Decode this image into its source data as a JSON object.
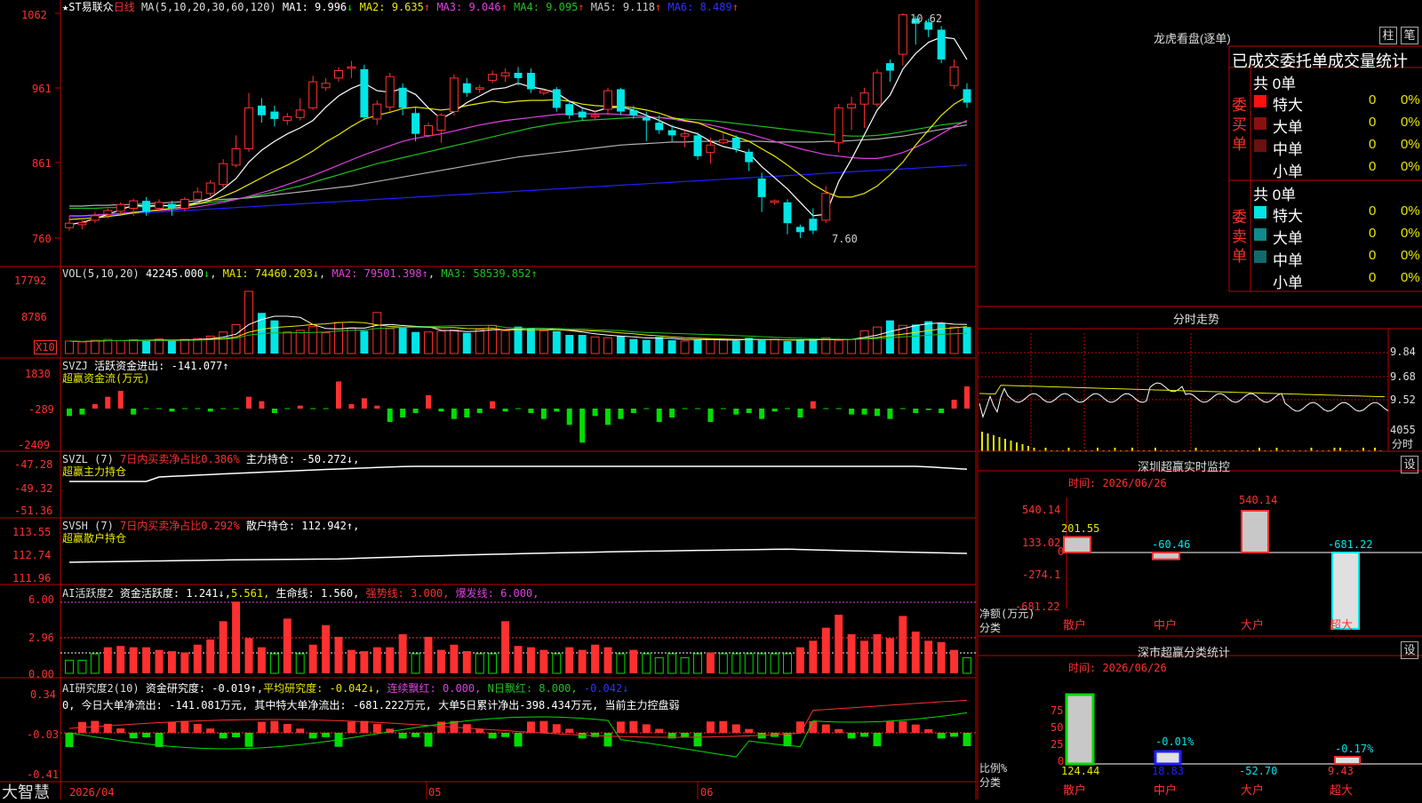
{
  "colors": {
    "up": "#ff3030",
    "down": "#00e5e5",
    "border": "#c00000",
    "ma1": "#ffffff",
    "ma2": "#e8e800",
    "ma3": "#e040e0",
    "ma4": "#20c020",
    "ma5": "#b0b0b0",
    "ma6": "#2020ff",
    "green": "#00dd00"
  },
  "header": {
    "stock": "★ST易联众",
    "period": "日线",
    "ma_label": "MA(5,10,20,30,60,120)",
    "ma": [
      {
        "name": "MA1",
        "value": "9.996",
        "arrow": "↓"
      },
      {
        "name": "MA2",
        "value": "9.635",
        "arrow": "↑"
      },
      {
        "name": "MA3",
        "value": "9.046",
        "arrow": "↑"
      },
      {
        "name": "MA4",
        "value": "9.095",
        "arrow": "↑"
      },
      {
        "name": "MA5",
        "value": "9.118",
        "arrow": "↑"
      },
      {
        "name": "MA6",
        "value": "8.489",
        "arrow": "↑"
      }
    ],
    "high_mark": "10.62",
    "low_mark": "7.60"
  },
  "price_axis": [
    "1062",
    "961",
    "861",
    "760"
  ],
  "vol": {
    "label": "VOL(5,10,20)",
    "value": "42245.000",
    "arrow": "↓",
    "ma1": "MA1: 74460.203↓",
    "ma2": "MA2: 79501.398↑",
    "ma3": "MA3: 58539.852↑",
    "axis": [
      "17792",
      "8786"
    ],
    "unit": "X10"
  },
  "svzj": {
    "label": "SVZJ",
    "title": "活跃资金进出: -141.077↑",
    "sub": "超赢资金流(万元)",
    "axis": [
      "1830",
      "-289",
      "-2409"
    ]
  },
  "svzl": {
    "label": "SVZL (7)",
    "pct": "7日内买卖净占比0.386%",
    "hold": "主力持仓: -50.272↓,",
    "sub": "超赢主力持仓",
    "axis": [
      "-47.28",
      "-49.32",
      "-51.36"
    ]
  },
  "svsh": {
    "label": "SVSH (7)",
    "pct": "7日内买卖净占比0.292%",
    "hold": "散户持仓: 112.942↑,",
    "sub": "超赢散户持仓",
    "axis": [
      "113.55",
      "112.74",
      "111.96"
    ]
  },
  "ai1": {
    "label": "AI活跃度2",
    "a": "资金活跃度: 1.241↓,",
    "b": "5.561,",
    "c": "生命线: 1.560,",
    "d": "强势线: 3.000,",
    "e": "爆发线: 6.000,",
    "axis": [
      "6.00",
      "2.96",
      "0.00"
    ]
  },
  "ai2": {
    "label": "AI研究度2(10)",
    "a": "资金研究度: -0.019↑,",
    "b": "平均研究度: -0.042↓,",
    "c": "连续飘红: 0.000,",
    "d": "N日飘红: 8.000,",
    "e": "-0.042↓",
    "note": "0, 今日大单净流出: -141.081万元, 其中特大单净流出: -681.222万元, 大单5日累计净出-398.434万元, 当前主力控盘弱",
    "axis": [
      "0.34",
      "-0.03",
      "-0.41"
    ]
  },
  "xaxis": {
    "labels": [
      "2026/04",
      "05",
      "06"
    ]
  },
  "brand": "大智慧",
  "right": {
    "title": "龙虎看盘(逐单)",
    "btn1": "柱",
    "btn2": "笔",
    "table_title": "已成交委托单成交量统计",
    "buy": {
      "side": "委买单",
      "total": "共 0单",
      "rows": [
        {
          "name": "特大",
          "v": "0",
          "p": "0%"
        },
        {
          "name": "大单",
          "v": "0",
          "p": "0%"
        },
        {
          "name": "中单",
          "v": "0",
          "p": "0%"
        },
        {
          "name": "小单",
          "v": "0",
          "p": "0%"
        }
      ]
    },
    "sell": {
      "side": "委卖单",
      "total": "共 0单",
      "rows": [
        {
          "name": "特大",
          "v": "0",
          "p": "0%"
        },
        {
          "name": "大单",
          "v": "0",
          "p": "0%"
        },
        {
          "name": "中单",
          "v": "0",
          "p": "0%"
        },
        {
          "name": "小单",
          "v": "0",
          "p": "0%"
        }
      ]
    },
    "intraday": {
      "title": "分时走势",
      "axis": [
        "9.84",
        "9.68",
        "9.52"
      ],
      "vol": "4055",
      "vol_unit": "分时"
    },
    "monitor": {
      "title": "深圳超赢实时监控",
      "btn": "设",
      "time": "时间: 2026/06/26",
      "axis": [
        "540.14",
        "133.02",
        "0",
        "-274.1",
        "-681.22"
      ],
      "ylabel": "净额(万元)",
      "xlabel": "分类",
      "cats": [
        "散户",
        "中户",
        "大户",
        "超大"
      ],
      "values": [
        "201.55",
        "-60.46",
        "540.14",
        "-681.22"
      ]
    },
    "stats": {
      "title": "深市超赢分类统计",
      "btn": "设",
      "time": "时间: 2026/06/26",
      "axis": [
        "75",
        "50",
        "25",
        "0"
      ],
      "ylabel": "比例%",
      "xlabel": "分类",
      "cats": [
        "散户",
        "中户",
        "大户",
        "超大"
      ],
      "values": [
        "124.44",
        "18.83",
        "-52.70",
        "9.43"
      ],
      "pct": [
        "-0.01%",
        "-0.17%"
      ]
    }
  },
  "chart_data": {
    "type": "candlestick",
    "ylim": [
      760,
      1062
    ],
    "candles": [
      {
        "o": 774,
        "c": 780,
        "h": 790,
        "l": 770
      },
      {
        "o": 778,
        "c": 781,
        "h": 784,
        "l": 772
      },
      {
        "o": 784,
        "c": 790,
        "h": 795,
        "l": 780
      },
      {
        "o": 792,
        "c": 797,
        "h": 800,
        "l": 786
      },
      {
        "o": 796,
        "c": 805,
        "h": 808,
        "l": 792
      },
      {
        "o": 800,
        "c": 810,
        "h": 813,
        "l": 790
      },
      {
        "o": 810,
        "c": 795,
        "h": 815,
        "l": 790
      },
      {
        "o": 800,
        "c": 808,
        "h": 812,
        "l": 796
      },
      {
        "o": 806,
        "c": 800,
        "h": 810,
        "l": 790
      },
      {
        "o": 800,
        "c": 812,
        "h": 815,
        "l": 796
      },
      {
        "o": 812,
        "c": 822,
        "h": 828,
        "l": 808
      },
      {
        "o": 820,
        "c": 834,
        "h": 838,
        "l": 816
      },
      {
        "o": 832,
        "c": 860,
        "h": 866,
        "l": 828
      },
      {
        "o": 858,
        "c": 880,
        "h": 898,
        "l": 855
      },
      {
        "o": 880,
        "c": 935,
        "h": 955,
        "l": 876
      },
      {
        "o": 938,
        "c": 925,
        "h": 948,
        "l": 915
      },
      {
        "o": 930,
        "c": 920,
        "h": 938,
        "l": 910
      },
      {
        "o": 918,
        "c": 923,
        "h": 928,
        "l": 912
      },
      {
        "o": 922,
        "c": 932,
        "h": 948,
        "l": 918
      },
      {
        "o": 935,
        "c": 970,
        "h": 978,
        "l": 932
      },
      {
        "o": 962,
        "c": 968,
        "h": 975,
        "l": 958
      },
      {
        "o": 975,
        "c": 985,
        "h": 990,
        "l": 970
      },
      {
        "o": 988,
        "c": 990,
        "h": 998,
        "l": 975
      },
      {
        "o": 987,
        "c": 922,
        "h": 993,
        "l": 918
      },
      {
        "o": 920,
        "c": 940,
        "h": 945,
        "l": 912
      },
      {
        "o": 936,
        "c": 977,
        "h": 982,
        "l": 930
      },
      {
        "o": 962,
        "c": 935,
        "h": 968,
        "l": 925
      },
      {
        "o": 928,
        "c": 900,
        "h": 935,
        "l": 890
      },
      {
        "o": 898,
        "c": 911,
        "h": 915,
        "l": 895
      },
      {
        "o": 905,
        "c": 925,
        "h": 928,
        "l": 888
      },
      {
        "o": 930,
        "c": 975,
        "h": 980,
        "l": 925
      },
      {
        "o": 968,
        "c": 955,
        "h": 975,
        "l": 950
      },
      {
        "o": 960,
        "c": 962,
        "h": 966,
        "l": 955
      },
      {
        "o": 972,
        "c": 980,
        "h": 985,
        "l": 968
      },
      {
        "o": 978,
        "c": 982,
        "h": 988,
        "l": 970
      },
      {
        "o": 982,
        "c": 975,
        "h": 990,
        "l": 965
      },
      {
        "o": 982,
        "c": 960,
        "h": 988,
        "l": 955
      },
      {
        "o": 955,
        "c": 958,
        "h": 960,
        "l": 952
      },
      {
        "o": 960,
        "c": 935,
        "h": 963,
        "l": 930
      },
      {
        "o": 940,
        "c": 925,
        "h": 945,
        "l": 920
      },
      {
        "o": 930,
        "c": 922,
        "h": 934,
        "l": 918
      },
      {
        "o": 923,
        "c": 925,
        "h": 932,
        "l": 918
      },
      {
        "o": 933,
        "c": 958,
        "h": 962,
        "l": 925
      },
      {
        "o": 960,
        "c": 930,
        "h": 962,
        "l": 925
      },
      {
        "o": 932,
        "c": 925,
        "h": 938,
        "l": 920
      },
      {
        "o": 922,
        "c": 918,
        "h": 930,
        "l": 890
      },
      {
        "o": 915,
        "c": 905,
        "h": 925,
        "l": 900
      },
      {
        "o": 905,
        "c": 898,
        "h": 912,
        "l": 890
      },
      {
        "o": 897,
        "c": 900,
        "h": 905,
        "l": 882
      },
      {
        "o": 898,
        "c": 870,
        "h": 902,
        "l": 865
      },
      {
        "o": 875,
        "c": 885,
        "h": 895,
        "l": 860
      },
      {
        "o": 888,
        "c": 892,
        "h": 902,
        "l": 886
      },
      {
        "o": 895,
        "c": 880,
        "h": 898,
        "l": 875
      },
      {
        "o": 876,
        "c": 862,
        "h": 880,
        "l": 850
      },
      {
        "o": 840,
        "c": 815,
        "h": 848,
        "l": 795
      },
      {
        "o": 808,
        "c": 810,
        "h": 812,
        "l": 805
      },
      {
        "o": 808,
        "c": 780,
        "h": 812,
        "l": 765
      },
      {
        "o": 775,
        "c": 768,
        "h": 778,
        "l": 760
      },
      {
        "o": 786,
        "c": 770,
        "h": 800,
        "l": 765
      },
      {
        "o": 784,
        "c": 820,
        "h": 830,
        "l": 780
      },
      {
        "o": 888,
        "c": 935,
        "h": 940,
        "l": 875
      },
      {
        "o": 935,
        "c": 940,
        "h": 950,
        "l": 905
      },
      {
        "o": 940,
        "c": 955,
        "h": 962,
        "l": 908
      },
      {
        "o": 940,
        "c": 982,
        "h": 987,
        "l": 936
      },
      {
        "o": 995,
        "c": 985,
        "h": 1000,
        "l": 970
      },
      {
        "o": 1007,
        "c": 1060,
        "h": 1062,
        "l": 992
      },
      {
        "o": 1055,
        "c": 1048,
        "h": 1058,
        "l": 1020
      },
      {
        "o": 1050,
        "c": 1040,
        "h": 1055,
        "l": 1030
      },
      {
        "o": 1040,
        "c": 1000,
        "h": 1045,
        "l": 995
      },
      {
        "o": 965,
        "c": 990,
        "h": 1000,
        "l": 960
      },
      {
        "o": 960,
        "c": 942,
        "h": 968,
        "l": 935
      }
    ],
    "ma5": [
      778,
      781,
      786,
      792,
      798,
      804,
      803,
      804,
      803,
      804,
      808,
      814,
      826,
      840,
      862,
      878,
      890,
      900,
      908,
      918,
      936,
      951,
      961,
      968,
      958,
      956,
      961,
      953,
      935,
      920,
      930,
      942,
      951,
      960,
      962,
      968,
      963,
      960,
      955,
      944,
      935,
      930,
      935,
      936,
      932,
      925,
      918,
      910,
      905,
      900,
      890,
      883,
      879,
      874,
      856,
      841,
      826,
      808,
      790,
      792,
      836,
      866,
      899,
      932,
      952,
      987,
      1008,
      1023,
      1030,
      1028,
      1000
    ],
    "ma10": [
      785,
      786,
      787,
      789,
      791,
      794,
      796,
      798,
      800,
      802,
      806,
      810,
      816,
      823,
      832,
      841,
      850,
      858,
      867,
      877,
      889,
      899,
      910,
      920,
      925,
      929,
      934,
      936,
      934,
      932,
      934,
      938,
      941,
      944,
      942,
      944,
      945,
      945,
      946,
      944,
      940,
      938,
      937,
      937,
      935,
      932,
      928,
      922,
      918,
      915,
      908,
      902,
      896,
      890,
      880,
      870,
      858,
      845,
      832,
      822,
      815,
      815,
      820,
      830,
      845,
      862,
      885,
      905,
      925,
      940,
      950
    ],
    "ma20": [
      790,
      790,
      791,
      792,
      793,
      795,
      796,
      797,
      798,
      800,
      802,
      805,
      808,
      812,
      816,
      821,
      826,
      832,
      838,
      844,
      851,
      858,
      865,
      872,
      878,
      884,
      890,
      894,
      897,
      900,
      904,
      908,
      912,
      915,
      918,
      920,
      922,
      924,
      926,
      927,
      927,
      927,
      927,
      926,
      925,
      923,
      922,
      920,
      917,
      915,
      912,
      908,
      904,
      900,
      895,
      890,
      885,
      880,
      876,
      872,
      870,
      868,
      867,
      867,
      870,
      875,
      882,
      890,
      900,
      910,
      918
    ],
    "ma30": [
      800,
      800,
      800,
      801,
      801,
      802,
      802,
      803,
      804,
      805,
      806,
      808,
      810,
      812,
      815,
      818,
      822,
      826,
      830,
      835,
      840,
      845,
      850,
      855,
      860,
      864,
      868,
      872,
      876,
      880,
      884,
      888,
      892,
      896,
      900,
      904,
      908,
      911,
      914,
      916,
      918,
      919,
      920,
      921,
      922,
      922,
      922,
      921,
      920,
      919,
      918,
      916,
      914,
      912,
      910,
      908,
      906,
      904,
      902,
      900,
      898,
      897,
      897,
      898,
      900,
      903,
      906,
      909,
      912,
      914,
      916
    ],
    "ma60": [
      803,
      803,
      804,
      804,
      805,
      805,
      806,
      807,
      808,
      809,
      810,
      811,
      812,
      813,
      814,
      816,
      818,
      820,
      822,
      824,
      826,
      828,
      830,
      833,
      836,
      839,
      842,
      845,
      848,
      851,
      854,
      857,
      860,
      863,
      866,
      869,
      871,
      873,
      875,
      877,
      879,
      881,
      883,
      885,
      886,
      887,
      888,
      889,
      889,
      890,
      890,
      890,
      890,
      890,
      890,
      889,
      889,
      889,
      889,
      890,
      890,
      891,
      892,
      893,
      895,
      897,
      900,
      903,
      906,
      909,
      912
    ],
    "ma120": [
      788,
      789,
      790,
      791,
      792,
      793,
      794,
      795,
      796,
      797,
      798,
      799,
      800,
      801,
      802,
      803,
      804,
      805,
      806,
      807,
      808,
      809,
      810,
      811,
      812,
      813,
      814,
      815,
      816,
      817,
      818,
      819,
      820,
      821,
      822,
      823,
      824,
      825,
      826,
      827,
      828,
      829,
      830,
      831,
      832,
      833,
      834,
      835,
      836,
      837,
      838,
      839,
      840,
      841,
      842,
      843,
      844,
      845,
      846,
      847,
      848,
      849,
      850,
      851,
      852,
      853,
      854,
      855,
      856,
      857,
      858
    ],
    "volume": [
      3000,
      2800,
      3200,
      3400,
      3100,
      3300,
      3000,
      3500,
      3300,
      3400,
      3600,
      4200,
      5200,
      7000,
      15000,
      9800,
      8000,
      5200,
      5600,
      6500,
      5000,
      7500,
      6200,
      5500,
      9900,
      6000,
      6200,
      5200,
      5200,
      5400,
      5700,
      5000,
      5800,
      6800,
      5500,
      6500,
      6000,
      5500,
      5400,
      4500,
      4500,
      4000,
      3800,
      4200,
      3500,
      3300,
      4000,
      3200,
      3000,
      3300,
      3500,
      3300,
      3100,
      3800,
      3200,
      3400,
      3000,
      3200,
      3500,
      3800,
      3200,
      3400,
      5500,
      6400,
      8000,
      6800,
      7000,
      7800,
      7400,
      6400,
      6400,
      6200,
      5800,
      4200
    ],
    "svzj": [
      -500,
      -400,
      300,
      800,
      1200,
      -400,
      0,
      0,
      -200,
      0,
      0,
      -200,
      0,
      0,
      800,
      500,
      -300,
      0,
      200,
      0,
      0,
      1830,
      300,
      700,
      200,
      -900,
      -600,
      -300,
      900,
      -200,
      -700,
      -600,
      -300,
      500,
      -200,
      0,
      -300,
      -700,
      -200,
      -1100,
      -2300,
      -500,
      -1100,
      -700,
      -300,
      0,
      -900,
      -600,
      0,
      0,
      -900,
      0,
      -400,
      -300,
      -700,
      -200,
      0,
      -600,
      500,
      0,
      0,
      -400,
      -400,
      -500,
      -700,
      0,
      -300,
      -100,
      -300,
      600,
      1500,
      700,
      1000,
      400,
      900,
      300,
      -200,
      -1200,
      -100
    ]
  }
}
